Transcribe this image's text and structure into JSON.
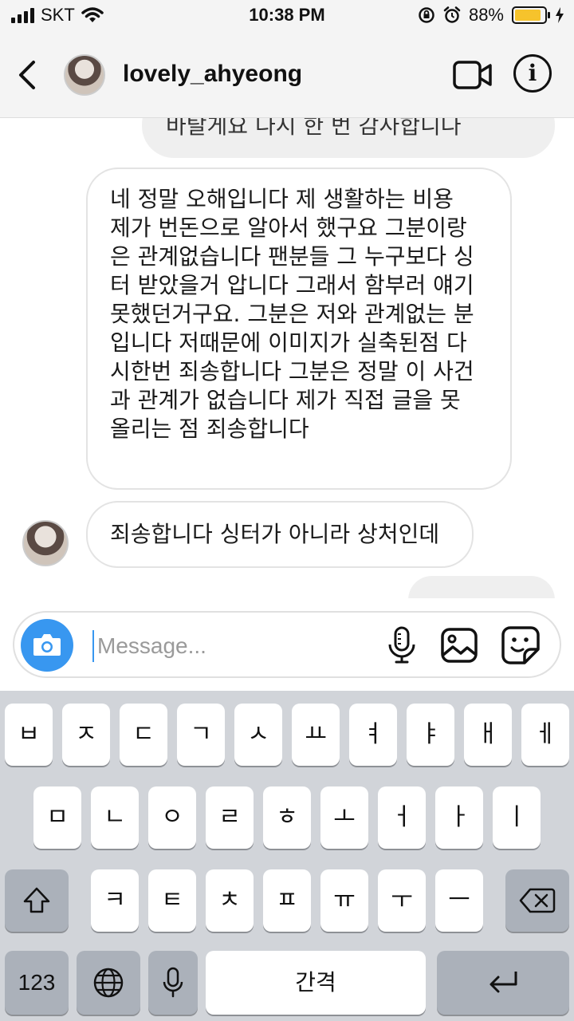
{
  "status_bar": {
    "carrier": "SKT",
    "time": "10:38 PM",
    "battery_percent": "88%",
    "battery_level": 0.88
  },
  "header": {
    "username": "lovely_ahyeong",
    "icons": [
      "back-chevron-icon",
      "video-camera-icon",
      "info-icon"
    ]
  },
  "messages": [
    {
      "text": "바탈게요 다시 한 번 감사합니다",
      "from": "me",
      "partial": true
    },
    {
      "lines": [
        "네 정말 오해입니다 제 생활하는 비용",
        "제가 번돈으로 알아서 했구요 그분이랑",
        "은 관계없습니다 팬분들 그 누구보다 싱",
        "터 받았을거 압니다 그래서 함부러 얘기",
        "못했던거구요. 그분은 저와 관계없는 분",
        "입니다 저때문에 이미지가 실축된점 다",
        "시한번 죄송합니다 그분은 정말 이 사건",
        "과 관계가 없습니다 제가 직접 글을 못",
        "올리는 점 죄송합니다"
      ],
      "from": "them"
    },
    {
      "text": "죄송합니다 싱터가 아니라 상처인데",
      "from": "them"
    }
  ],
  "composer": {
    "placeholder": "Message...",
    "icons": [
      "camera-icon",
      "microphone-icon",
      "gallery-icon",
      "sticker-icon"
    ]
  },
  "keyboard": {
    "row1": [
      "ㅂ",
      "ㅈ",
      "ㄷ",
      "ㄱ",
      "ㅅ",
      "ㅛ",
      "ㅕ",
      "ㅑ",
      "ㅐ",
      "ㅔ"
    ],
    "row2": [
      "ㅁ",
      "ㄴ",
      "ㅇ",
      "ㄹ",
      "ㅎ",
      "ㅗ",
      "ㅓ",
      "ㅏ",
      "ㅣ"
    ],
    "row3": [
      "ㅋ",
      "ㅌ",
      "ㅊ",
      "ㅍ",
      "ㅠ",
      "ㅜ",
      "ㅡ"
    ],
    "numbers_key": "123",
    "space_key": "간격",
    "icons": [
      "shift-icon",
      "delete-icon",
      "globe-icon",
      "keyboard-mic-icon",
      "return-icon"
    ]
  },
  "colors": {
    "accent": "#3897f0",
    "battery": "#f6c32c",
    "keyboard_bg": "#d1d4d9"
  }
}
